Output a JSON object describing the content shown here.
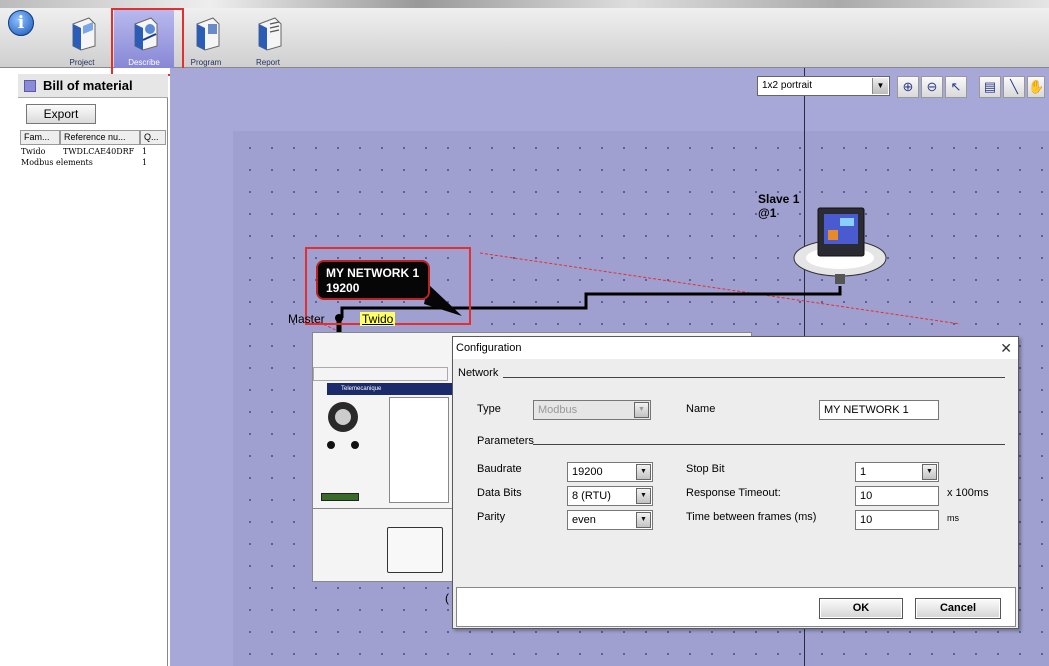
{
  "toolbar": {
    "info_icon": "info-icon",
    "tools": [
      {
        "label": "Project",
        "icon": "project-icon"
      },
      {
        "label": "Describe",
        "icon": "describe-icon"
      },
      {
        "label": "Program",
        "icon": "program-icon"
      },
      {
        "label": "Report",
        "icon": "report-icon"
      }
    ],
    "active_tool": "Describe"
  },
  "bom": {
    "title": "Bill of material",
    "export_label": "Export",
    "columns": [
      "Fam...",
      "Reference nu...",
      "Q..."
    ],
    "rows": [
      {
        "family": "Twido",
        "reference": "TWDLCAE40DRF",
        "qty": "1"
      },
      {
        "family": "Modbus elements",
        "reference": "",
        "qty": "1"
      }
    ]
  },
  "canvas": {
    "layout_select": "1x2 portrait",
    "zoom_tools": [
      "zoom-in-icon",
      "zoom-out-icon",
      "pointer-icon",
      "page-icon",
      "line-tool-icon",
      "hand-icon"
    ],
    "network_callout": {
      "name": "MY NETWORK 1",
      "baud": "19200"
    },
    "master_label": "Master",
    "twido_label": "Twido",
    "slave_label": {
      "name": "Slave 1",
      "address": "@1"
    },
    "device_brand": "Telemecanique",
    "partial_char": "("
  },
  "dialog": {
    "title": "Configuration",
    "network_group": "Network",
    "type_label": "Type",
    "type_value": "Modbus",
    "name_label": "Name",
    "name_value": "MY NETWORK 1",
    "parameters_group": "Parameters",
    "baudrate_label": "Baudrate",
    "baudrate_value": "19200",
    "databits_label": "Data Bits",
    "databits_value": "8 (RTU)",
    "parity_label": "Parity",
    "parity_value": "even",
    "stopbit_label": "Stop Bit",
    "stopbit_value": "1",
    "response_timeout_label": "Response Timeout:",
    "response_timeout_value": "10",
    "response_timeout_unit": "x 100ms",
    "time_between_label": "Time between frames (ms)",
    "time_between_value": "10",
    "time_between_unit": "ms",
    "ok_label": "OK",
    "cancel_label": "Cancel"
  },
  "colors": {
    "canvas_bg": "#a7a7d8",
    "highlight_red": "#e23030",
    "callout_bg": "#060606",
    "twido_label_bg": "#ffff66"
  }
}
